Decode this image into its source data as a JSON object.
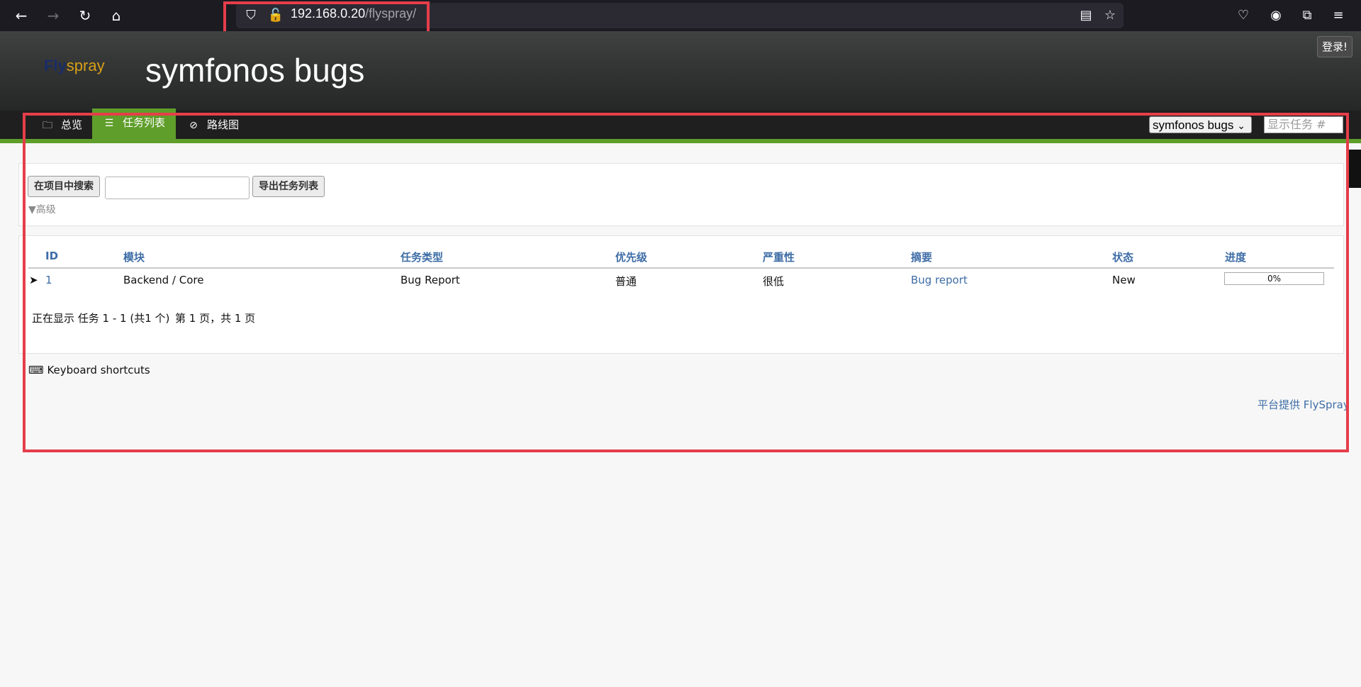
{
  "browser": {
    "url_host": "192.168.0.20",
    "url_path": "/flyspray/"
  },
  "header": {
    "logo_fly": "Fly",
    "logo_spray": "spray",
    "title": "symfonos bugs",
    "login": "登录!"
  },
  "nav": {
    "tabs": [
      {
        "label": "总览",
        "icon": "folder-icon"
      },
      {
        "label": "任务列表",
        "icon": "list-icon"
      },
      {
        "label": "路线图",
        "icon": "compass-icon"
      }
    ],
    "active_tab": 1,
    "project_select": "symfonos bugs",
    "task_placeholder": "显示任务 #"
  },
  "search": {
    "search_button": "在项目中搜索",
    "search_value": "",
    "export_button": "导出任务列表",
    "advanced": "▼高级"
  },
  "table": {
    "headers": [
      "ID",
      "模块",
      "任务类型",
      "优先级",
      "严重性",
      "摘要",
      "状态",
      "进度"
    ],
    "rows": [
      {
        "id": "1",
        "module": "Backend / Core",
        "type": "Bug Report",
        "priority": "普通",
        "severity": "很低",
        "summary": "Bug report",
        "status": "New",
        "progress": "0%",
        "progress_fraction": 0
      }
    ]
  },
  "pagination": {
    "showing": "正在显示 任务 1 - 1 (共1 个)",
    "pages": "第 1 页，共 1 页"
  },
  "keyboard_shortcuts": "Keyboard shortcuts",
  "footer": "平台提供 FlySpray",
  "colors": {
    "accent_green": "#5f9e2a",
    "link_blue": "#3e6da6",
    "highlight_red": "#e53e4a"
  }
}
